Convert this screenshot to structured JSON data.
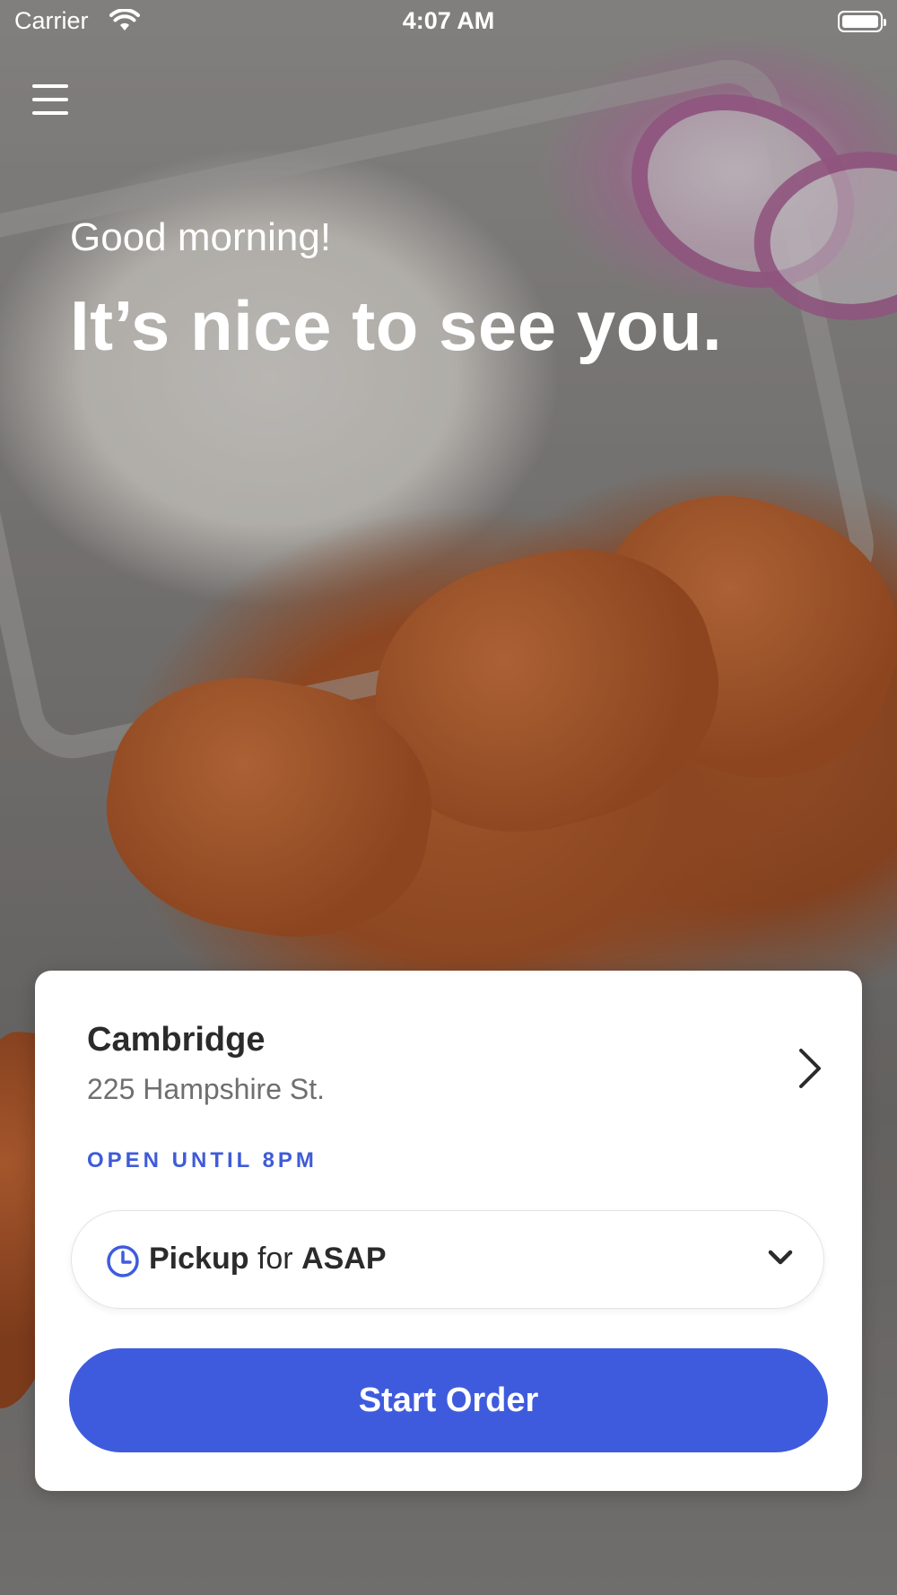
{
  "status_bar": {
    "carrier": "Carrier",
    "time": "4:07 AM"
  },
  "icons": {
    "menu": "hamburger-menu-icon",
    "wifi": "wifi-icon",
    "battery": "battery-icon",
    "chevron_right": "chevron-right-icon",
    "clock": "clock-icon",
    "chevron_down": "chevron-down-icon"
  },
  "hero": {
    "greeting": "Good morning!",
    "headline": "It’s nice to see you."
  },
  "location": {
    "name": "Cambridge",
    "address": "225 Hampshire St.",
    "hours": "OPEN UNTIL 8PM"
  },
  "order_mode": {
    "mode": "Pickup",
    "connector": "for",
    "time": "ASAP"
  },
  "actions": {
    "start_order": "Start Order"
  },
  "colors": {
    "accent": "#3f5bdd",
    "hours_text": "#3f5bd8",
    "card_bg": "#ffffff"
  }
}
